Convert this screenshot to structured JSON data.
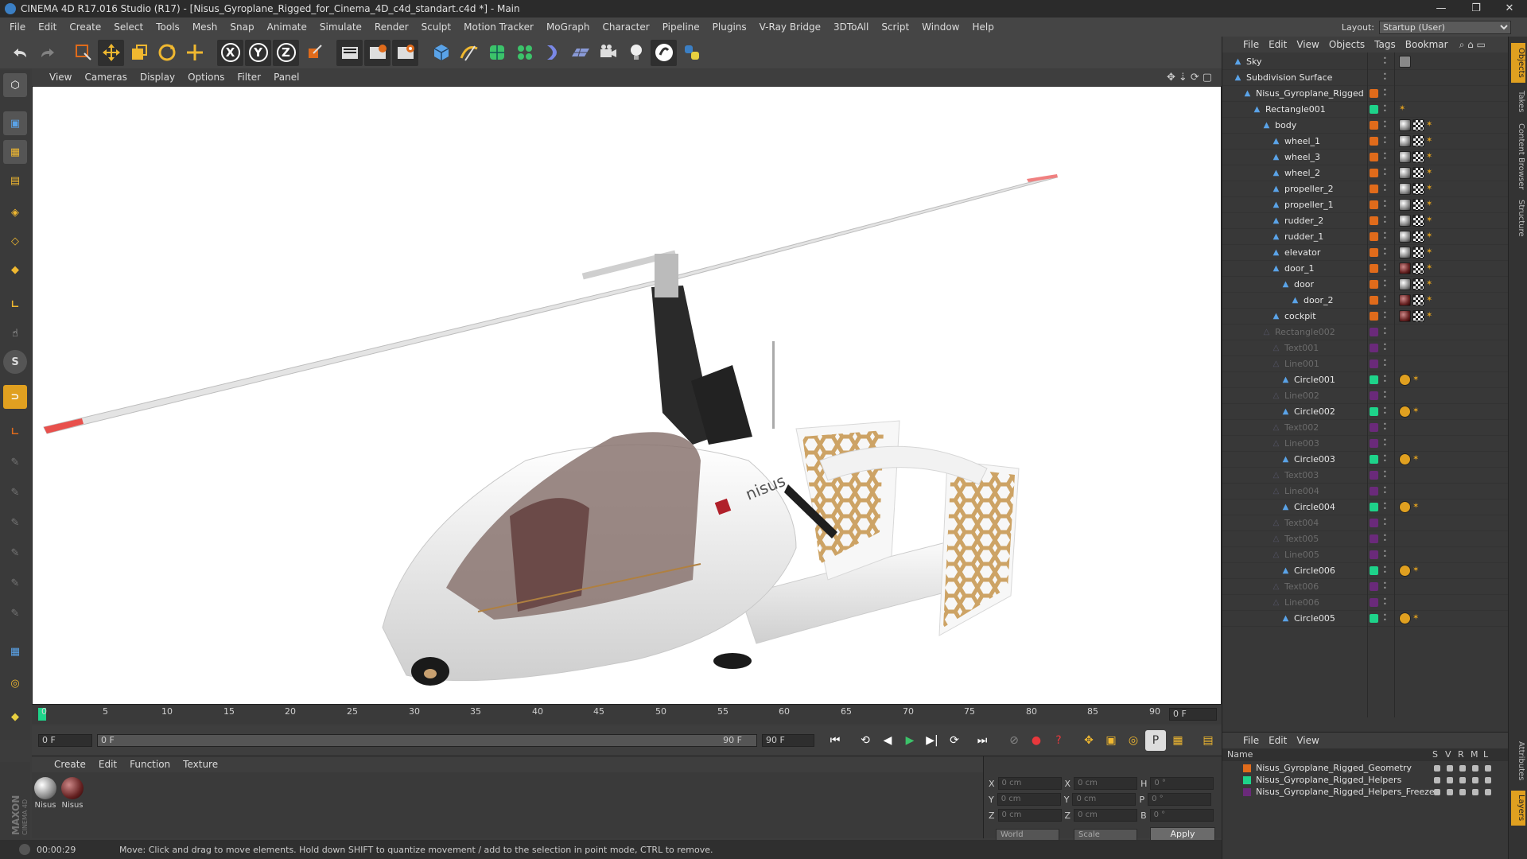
{
  "window": {
    "title": "CINEMA 4D R17.016 Studio (R17) - [Nisus_Gyroplane_Rigged_for_Cinema_4D_c4d_standart.c4d *] - Main",
    "controls": [
      "—",
      "❐",
      "✕"
    ]
  },
  "menu": [
    "File",
    "Edit",
    "Create",
    "Select",
    "Tools",
    "Mesh",
    "Snap",
    "Animate",
    "Simulate",
    "Render",
    "Sculpt",
    "Motion Tracker",
    "MoGraph",
    "Character",
    "Pipeline",
    "Plugins",
    "V-Ray Bridge",
    "3DToAll",
    "Script",
    "Window",
    "Help"
  ],
  "layout": {
    "label": "Layout:",
    "value": "Startup (User)"
  },
  "toolbar_icons": [
    "undo-icon",
    "redo-icon",
    "live-selection-icon",
    "move-icon",
    "scale-icon",
    "rotate-icon",
    "last-tool-icon",
    "x-axis-icon",
    "y-axis-icon",
    "z-axis-icon",
    "coordinate-system-icon",
    "render-view-icon",
    "render-picture-viewer-icon",
    "render-settings-icon",
    "cube-icon",
    "pen-spline-icon",
    "subdivision-icon",
    "cloner-icon",
    "deformer-icon",
    "floor-icon",
    "camera-icon",
    "light-icon",
    "stop-icon",
    "python-icon"
  ],
  "toolbar_letters": {
    "x": "X",
    "y": "Y",
    "z": "Z"
  },
  "viewport": {
    "menu": [
      "View",
      "Cameras",
      "Display",
      "Options",
      "Filter",
      "Panel"
    ],
    "brand_text": "nisus"
  },
  "timeline": {
    "ticks": [
      "0",
      "5",
      "10",
      "15",
      "20",
      "25",
      "30",
      "35",
      "40",
      "45",
      "50",
      "55",
      "60",
      "65",
      "70",
      "75",
      "80",
      "85",
      "90"
    ],
    "end_frame_box": "0 F",
    "current_frame": "0 F",
    "range_start": "0 F",
    "range_end": "90 F",
    "max_frame": "90 F",
    "current_frame_position": 0
  },
  "materials": {
    "menu": [
      "Create",
      "Edit",
      "Function",
      "Texture"
    ],
    "items": [
      {
        "label": "Nisus"
      },
      {
        "label": "Nisus"
      }
    ]
  },
  "coordinates": {
    "rows": [
      {
        "a": "X",
        "av": "0 cm",
        "b": "X",
        "bv": "0 cm",
        "c": "H",
        "cv": "0 °"
      },
      {
        "a": "Y",
        "av": "0 cm",
        "b": "Y",
        "bv": "0 cm",
        "c": "P",
        "cv": "0 °"
      },
      {
        "a": "Z",
        "av": "0 cm",
        "b": "Z",
        "bv": "0 cm",
        "c": "B",
        "cv": "0 °"
      }
    ],
    "space": "World",
    "mode": "Scale",
    "apply": "Apply"
  },
  "status": {
    "time": "00:00:29",
    "message": "Move: Click and drag to move elements. Hold down SHIFT to quantize movement / add to the selection in point mode, CTRL to remove."
  },
  "objects": {
    "menu": [
      "File",
      "Edit",
      "View",
      "Objects",
      "Tags",
      "Bookmar"
    ],
    "rows": [
      {
        "name": "Sky",
        "indent": 0,
        "dim": false,
        "layer": "",
        "tags": [
          "sky"
        ]
      },
      {
        "name": "Subdivision Surface",
        "indent": 0,
        "dim": false,
        "layer": "",
        "tags": []
      },
      {
        "name": "Nisus_Gyroplane_Rigged",
        "indent": 1,
        "dim": false,
        "layer": "#e06b1b",
        "tags": []
      },
      {
        "name": "Rectangle001",
        "indent": 2,
        "dim": false,
        "layer": "#1ed38a",
        "tags": [
          "ik"
        ]
      },
      {
        "name": "body",
        "indent": 3,
        "dim": false,
        "layer": "#e06b1b",
        "tags": [
          "mat",
          "chk",
          "ik"
        ]
      },
      {
        "name": "wheel_1",
        "indent": 4,
        "dim": false,
        "layer": "#e06b1b",
        "tags": [
          "mat",
          "chk",
          "ik"
        ]
      },
      {
        "name": "wheel_3",
        "indent": 4,
        "dim": false,
        "layer": "#e06b1b",
        "tags": [
          "mat",
          "chk",
          "ik"
        ]
      },
      {
        "name": "wheel_2",
        "indent": 4,
        "dim": false,
        "layer": "#e06b1b",
        "tags": [
          "mat",
          "chk",
          "ik"
        ]
      },
      {
        "name": "propeller_2",
        "indent": 4,
        "dim": false,
        "layer": "#e06b1b",
        "tags": [
          "mat",
          "chk",
          "ik"
        ]
      },
      {
        "name": "propeller_1",
        "indent": 4,
        "dim": false,
        "layer": "#e06b1b",
        "tags": [
          "mat",
          "chk",
          "ik"
        ]
      },
      {
        "name": "rudder_2",
        "indent": 4,
        "dim": false,
        "layer": "#e06b1b",
        "tags": [
          "mat",
          "chk",
          "ik"
        ]
      },
      {
        "name": "rudder_1",
        "indent": 4,
        "dim": false,
        "layer": "#e06b1b",
        "tags": [
          "mat",
          "chk",
          "ik"
        ]
      },
      {
        "name": "elevator",
        "indent": 4,
        "dim": false,
        "layer": "#e06b1b",
        "tags": [
          "mat",
          "chk",
          "ik"
        ]
      },
      {
        "name": "door_1",
        "indent": 4,
        "dim": false,
        "layer": "#e06b1b",
        "tags": [
          "dark",
          "chk",
          "ik"
        ]
      },
      {
        "name": "door",
        "indent": 5,
        "dim": false,
        "layer": "#e06b1b",
        "tags": [
          "mat",
          "chk",
          "ik"
        ]
      },
      {
        "name": "door_2",
        "indent": 6,
        "dim": false,
        "layer": "#e06b1b",
        "tags": [
          "dark",
          "chk",
          "ik"
        ]
      },
      {
        "name": "cockpit",
        "indent": 4,
        "dim": false,
        "layer": "#e06b1b",
        "tags": [
          "dark",
          "chk",
          "ik"
        ]
      },
      {
        "name": "Rectangle002",
        "indent": 3,
        "dim": true,
        "layer": "#6a2a7a",
        "tags": []
      },
      {
        "name": "Text001",
        "indent": 4,
        "dim": true,
        "layer": "#6a2a7a",
        "tags": []
      },
      {
        "name": "Line001",
        "indent": 4,
        "dim": true,
        "layer": "#6a2a7a",
        "tags": []
      },
      {
        "name": "Circle001",
        "indent": 5,
        "dim": false,
        "layer": "#1ed38a",
        "tags": [
          "stop",
          "ik"
        ]
      },
      {
        "name": "Line002",
        "indent": 4,
        "dim": true,
        "layer": "#6a2a7a",
        "tags": []
      },
      {
        "name": "Circle002",
        "indent": 5,
        "dim": false,
        "layer": "#1ed38a",
        "tags": [
          "stop",
          "ik"
        ]
      },
      {
        "name": "Text002",
        "indent": 4,
        "dim": true,
        "layer": "#6a2a7a",
        "tags": []
      },
      {
        "name": "Line003",
        "indent": 4,
        "dim": true,
        "layer": "#6a2a7a",
        "tags": []
      },
      {
        "name": "Circle003",
        "indent": 5,
        "dim": false,
        "layer": "#1ed38a",
        "tags": [
          "stop",
          "ik"
        ]
      },
      {
        "name": "Text003",
        "indent": 4,
        "dim": true,
        "layer": "#6a2a7a",
        "tags": []
      },
      {
        "name": "Line004",
        "indent": 4,
        "dim": true,
        "layer": "#6a2a7a",
        "tags": []
      },
      {
        "name": "Circle004",
        "indent": 5,
        "dim": false,
        "layer": "#1ed38a",
        "tags": [
          "stop",
          "ik"
        ]
      },
      {
        "name": "Text004",
        "indent": 4,
        "dim": true,
        "layer": "#6a2a7a",
        "tags": []
      },
      {
        "name": "Text005",
        "indent": 4,
        "dim": true,
        "layer": "#6a2a7a",
        "tags": []
      },
      {
        "name": "Line005",
        "indent": 4,
        "dim": true,
        "layer": "#6a2a7a",
        "tags": []
      },
      {
        "name": "Circle006",
        "indent": 5,
        "dim": false,
        "layer": "#1ed38a",
        "tags": [
          "stop",
          "ik"
        ]
      },
      {
        "name": "Text006",
        "indent": 4,
        "dim": true,
        "layer": "#6a2a7a",
        "tags": []
      },
      {
        "name": "Line006",
        "indent": 4,
        "dim": true,
        "layer": "#6a2a7a",
        "tags": []
      },
      {
        "name": "Circle005",
        "indent": 5,
        "dim": false,
        "layer": "#1ed38a",
        "tags": [
          "stop",
          "ik"
        ]
      }
    ]
  },
  "layers": {
    "menu": [
      "File",
      "Edit",
      "View"
    ],
    "header": {
      "name": "Name",
      "cols": [
        "S",
        "V",
        "R",
        "M",
        "L"
      ]
    },
    "rows": [
      {
        "name": "Nisus_Gyroplane_Rigged_Geometry",
        "color": "#e06b1b"
      },
      {
        "name": "Nisus_Gyroplane_Rigged_Helpers",
        "color": "#1ed38a"
      },
      {
        "name": "Nisus_Gyroplane_Rigged_Helpers_Freeze",
        "color": "#6a2a7a"
      }
    ]
  },
  "right_tabs": [
    "Objects",
    "Takes",
    "Content Browser",
    "Structure",
    "Attributes",
    "Layers"
  ],
  "colors": {
    "accent_orange": "#e0a020",
    "accent_blue": "#3b7fc4",
    "selected_green": "#1ed38a"
  }
}
